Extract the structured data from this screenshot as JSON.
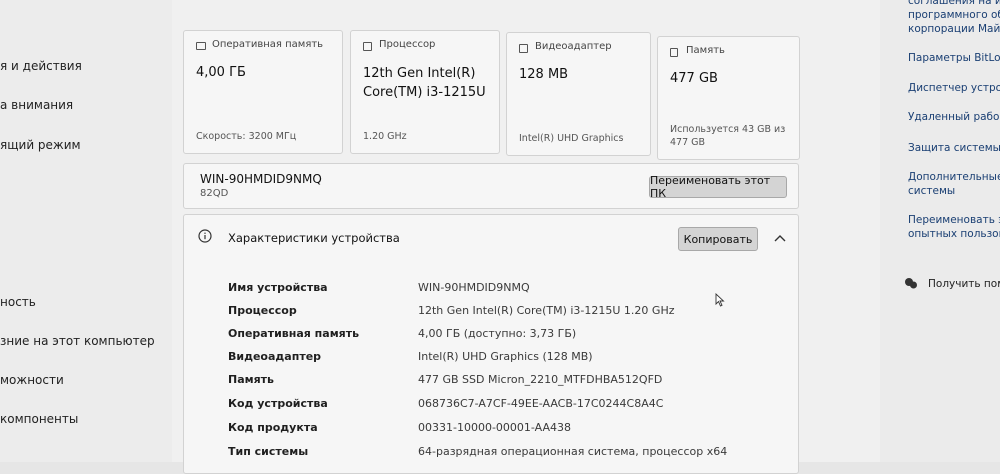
{
  "left_nav": [
    "я и действия",
    "а внимания",
    "ящий режим",
    "ность",
    "зние на этот компьютер",
    "можности",
    "компоненты"
  ],
  "cards": [
    {
      "icon": "memory-icon",
      "label": "Оперативная память",
      "value": "4,00 ГБ",
      "sub": "Скорость: 3200 МГц"
    },
    {
      "icon": "processor-icon",
      "label": "Процессор",
      "value": "12th Gen Intel(R) Core(TM) i3-1215U",
      "sub": "1.20 GHz"
    },
    {
      "icon": "gpu-icon",
      "label": "Видеоадаптер",
      "value": "128 MB",
      "sub": "Intel(R) UHD Graphics"
    },
    {
      "icon": "storage-icon",
      "label": "Память",
      "value": "477 GB",
      "sub": "Используется 43 GB из 477 GB"
    }
  ],
  "pc": {
    "name": "WIN-90HMDID9NMQ",
    "model": "82QD",
    "rename_label": "Переименовать этот ПК"
  },
  "device_specs": {
    "title": "Характеристики устройства",
    "copy_label": "Копировать",
    "rows": [
      {
        "key": "Имя устройства",
        "value": "WIN-90HMDID9NMQ"
      },
      {
        "key": "Процессор",
        "value": "12th Gen Intel(R) Core(TM) i3-1215U   1.20 GHz"
      },
      {
        "key": "Оперативная память",
        "value": "4,00 ГБ (доступно: 3,73 ГБ)"
      },
      {
        "key": "Видеоадаптер",
        "value": "Intel(R) UHD Graphics (128 MB)"
      },
      {
        "key": "Память",
        "value": "477 GB SSD Micron_2210_MTFDHBA512QFD"
      },
      {
        "key": "Код устройства",
        "value": "068736C7-A7CF-49EE-AACB-17C0244C8A4C"
      },
      {
        "key": "Код продукта",
        "value": "00331-10000-00001-AA438"
      },
      {
        "key": "Тип системы",
        "value": "64-разрядная операционная система, процессор x64"
      }
    ]
  },
  "right_panel": {
    "top_lines": [
      "соглашения на ис",
      "программного обе",
      "корпорации Майкр"
    ],
    "links": [
      {
        "lines": [
          "Параметры BitLock"
        ]
      },
      {
        "lines": [
          "Диспетчер устройс"
        ]
      },
      {
        "lines": [
          "Удаленный рабочи"
        ]
      },
      {
        "lines": [
          "Защита системы"
        ]
      },
      {
        "lines": [
          "Дополнительные па",
          "системы"
        ]
      },
      {
        "lines": [
          "Переименовать это",
          "опытных пользоват"
        ]
      }
    ],
    "help": "Получить помощ"
  }
}
